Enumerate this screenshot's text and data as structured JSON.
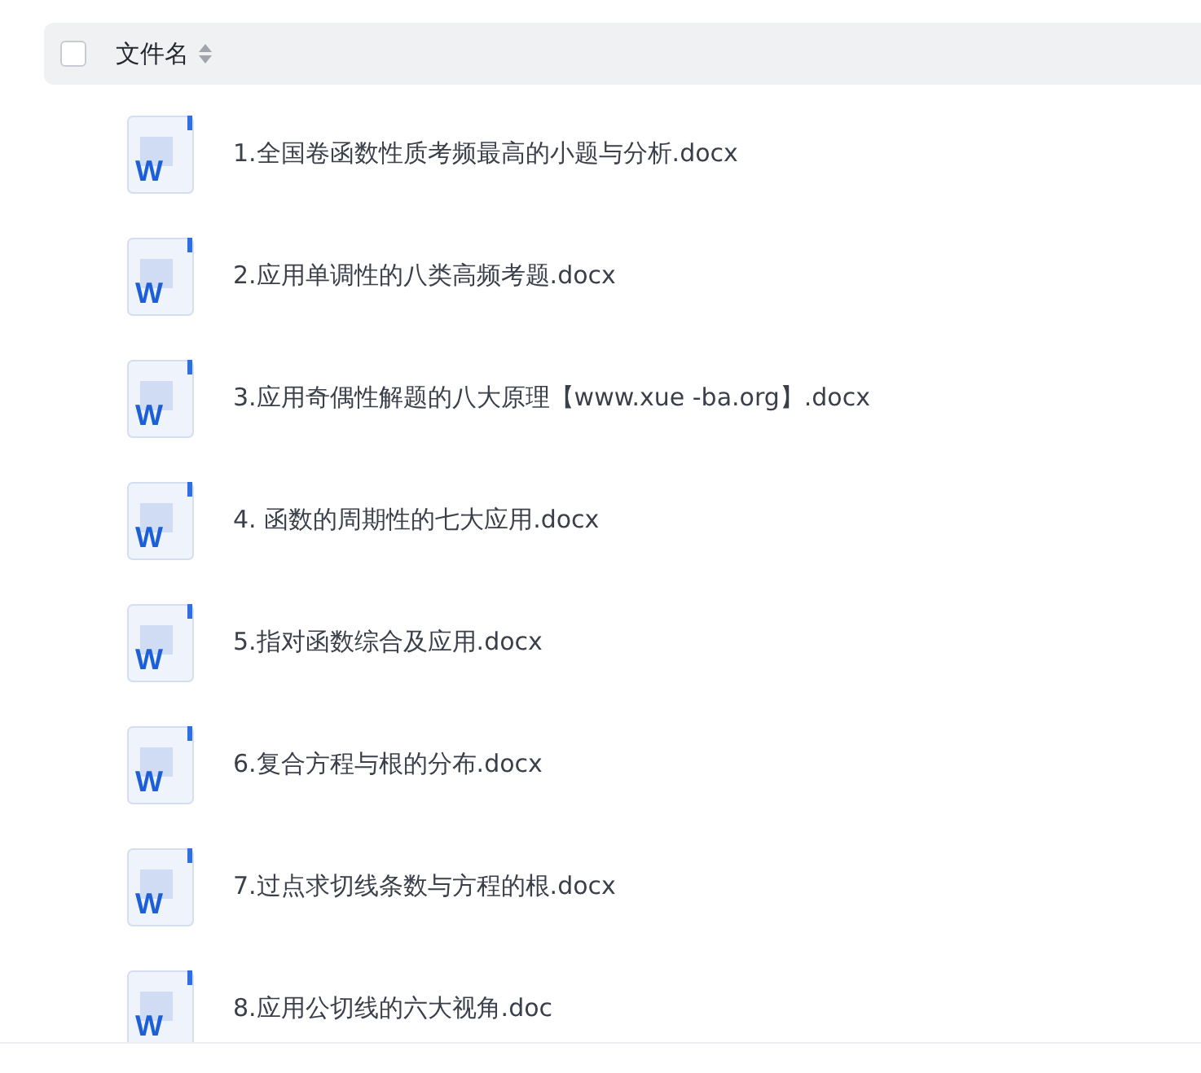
{
  "header": {
    "checked": false,
    "column_label": "文件名"
  },
  "files": [
    {
      "name": "1.全国卷函数性质考频最高的小题与分析.docx",
      "icon_text": "W"
    },
    {
      "name": "2.应用单调性的八类高频考题.docx",
      "icon_text": "W"
    },
    {
      "name": "3.应用奇偶性解题的八大原理【www.xue -ba.org】.docx",
      "icon_text": "W"
    },
    {
      "name": "4. 函数的周期性的七大应用.docx",
      "icon_text": "W"
    },
    {
      "name": "5.指对函数综合及应用.docx",
      "icon_text": "W"
    },
    {
      "name": "6.复合方程与根的分布.docx",
      "icon_text": "W"
    },
    {
      "name": "7.过点求切线条数与方程的根.docx",
      "icon_text": "W"
    },
    {
      "name": "8.应用公切线的六大视角.doc",
      "icon_text": "W"
    }
  ]
}
